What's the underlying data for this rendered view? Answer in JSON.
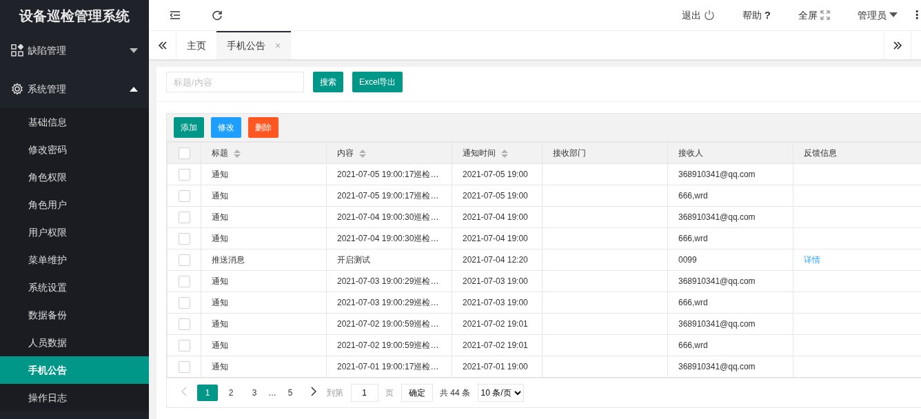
{
  "app_title": "设备巡检管理系统",
  "sidebar": {
    "groups": [
      {
        "label": "缺陷管理",
        "expanded": false
      },
      {
        "label": "系统管理",
        "expanded": true,
        "children": [
          {
            "label": "基础信息",
            "selected": false
          },
          {
            "label": "修改密码",
            "selected": false
          },
          {
            "label": "角色权限",
            "selected": false
          },
          {
            "label": "角色用户",
            "selected": false
          },
          {
            "label": "用户权限",
            "selected": false
          },
          {
            "label": "菜单维护",
            "selected": false
          },
          {
            "label": "系统设置",
            "selected": false
          },
          {
            "label": "数据备份",
            "selected": false
          },
          {
            "label": "人员数据",
            "selected": false
          },
          {
            "label": "手机公告",
            "selected": true
          },
          {
            "label": "操作日志",
            "selected": false
          }
        ]
      }
    ]
  },
  "header": {
    "actions": [
      {
        "label": "退出"
      },
      {
        "label": "帮助",
        "glyph": "?"
      },
      {
        "label": "全屏"
      },
      {
        "label": "管理员"
      }
    ],
    "more": "⋮"
  },
  "tabs": [
    {
      "label": "主页",
      "selected": false
    },
    {
      "label": "手机公告",
      "selected": true,
      "close": "×"
    }
  ],
  "search": {
    "placeholder": "标题/内容",
    "buttons": [
      "搜索",
      "Excel导出"
    ]
  },
  "toolbar": [
    {
      "label": "添加",
      "kind": "primary"
    },
    {
      "label": "修改",
      "kind": "info"
    },
    {
      "label": "删除",
      "kind": "danger"
    }
  ],
  "table": {
    "all_checked": false,
    "columns": [
      {
        "label": "标题",
        "sortable": true
      },
      {
        "label": "内容",
        "sortable": true
      },
      {
        "label": "通知时间",
        "sortable": true
      },
      {
        "label": "接收部门",
        "sortable": false
      },
      {
        "label": "接收人",
        "sortable": false
      },
      {
        "label": "反馈信息",
        "sortable": false
      }
    ],
    "rows": [
      {
        "checked": false,
        "cells": [
          "通知",
          "2021-07-05 19:00:17巡检…",
          "2021-07-05 19:00",
          "",
          "368910341@qq.com",
          ""
        ]
      },
      {
        "checked": false,
        "cells": [
          "通知",
          "2021-07-05 19:00:17巡检…",
          "2021-07-05 19:00",
          "",
          "666,wrd",
          ""
        ]
      },
      {
        "checked": false,
        "cells": [
          "通知",
          "2021-07-04 19:00:30巡检…",
          "2021-07-04 19:00",
          "",
          "368910341@qq.com",
          ""
        ]
      },
      {
        "checked": false,
        "cells": [
          "通知",
          "2021-07-04 19:00:30巡检…",
          "2021-07-04 19:00",
          "",
          "666,wrd",
          ""
        ]
      },
      {
        "checked": false,
        "cells": [
          "推送消息",
          "开启测试",
          "2021-07-04 12:20",
          "",
          "0099",
          "详情"
        ]
      },
      {
        "checked": false,
        "cells": [
          "通知",
          "2021-07-03 19:00:29巡检…",
          "2021-07-03 19:00",
          "",
          "368910341@qq.com",
          ""
        ]
      },
      {
        "checked": false,
        "cells": [
          "通知",
          "2021-07-03 19:00:29巡检…",
          "2021-07-03 19:00",
          "",
          "666,wrd",
          ""
        ]
      },
      {
        "checked": false,
        "cells": [
          "通知",
          "2021-07-02 19:00:59巡检…",
          "2021-07-02 19:01",
          "",
          "368910341@qq.com",
          ""
        ]
      },
      {
        "checked": false,
        "cells": [
          "通知",
          "2021-07-02 19:00:59巡检…",
          "2021-07-02 19:01",
          "",
          "666,wrd",
          ""
        ]
      },
      {
        "checked": false,
        "cells": [
          "通知",
          "2021-07-01 19:00:17巡检…",
          "2021-07-01 19:00",
          "",
          "368910341@qq.com",
          ""
        ]
      }
    ]
  },
  "pagination": {
    "pages": [
      {
        "label": "1",
        "selected": true
      },
      {
        "label": "2",
        "selected": false
      },
      {
        "label": "3",
        "selected": false
      },
      {
        "label": "…",
        "selected": false
      },
      {
        "label": "5",
        "selected": false
      }
    ],
    "prev_disabled": true,
    "goto_label": "到第",
    "goto_value": "1",
    "page_unit": "页",
    "confirm": "确定",
    "total": "共 44 条",
    "page_size": "10 条/页"
  }
}
